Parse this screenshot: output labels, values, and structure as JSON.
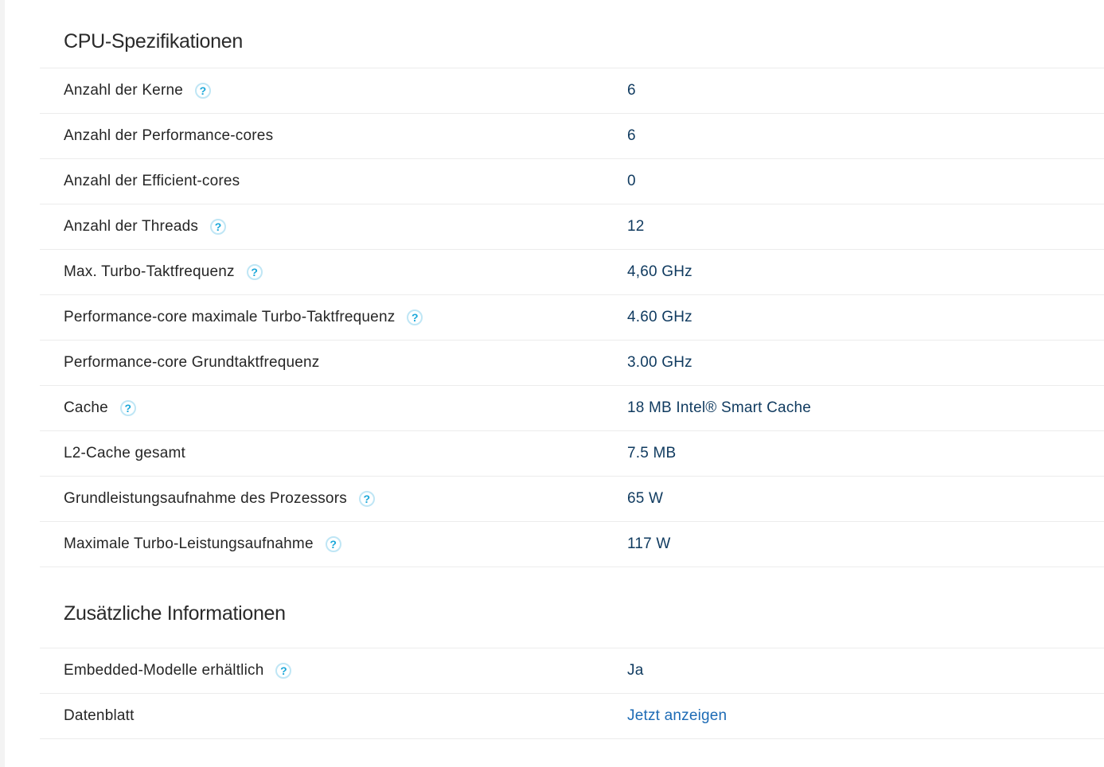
{
  "cpu_spec": {
    "title": "CPU-Spezifikationen",
    "rows": [
      {
        "label": "Anzahl der Kerne",
        "value": "6",
        "help": true
      },
      {
        "label": "Anzahl der Performance-cores",
        "value": "6",
        "help": false
      },
      {
        "label": "Anzahl der Efficient-cores",
        "value": "0",
        "help": false
      },
      {
        "label": "Anzahl der Threads",
        "value": "12",
        "help": true
      },
      {
        "label": "Max. Turbo-Taktfrequenz",
        "value": "4,60 GHz",
        "help": true
      },
      {
        "label": "Performance-core maximale Turbo-Taktfrequenz",
        "value": "4.60 GHz",
        "help": true
      },
      {
        "label": "Performance-core Grundtaktfrequenz",
        "value": "3.00 GHz",
        "help": false
      },
      {
        "label": "Cache",
        "value": "18 MB Intel® Smart Cache",
        "help": true
      },
      {
        "label": "L2-Cache gesamt",
        "value": "7.5 MB",
        "help": false
      },
      {
        "label": "Grundleistungsaufnahme des Prozessors",
        "value": "65 W",
        "help": true
      },
      {
        "label": "Maximale Turbo-Leistungsaufnahme",
        "value": "117 W",
        "help": true
      }
    ]
  },
  "additional_info": {
    "title": "Zusätzliche Informationen",
    "rows": [
      {
        "label": "Embedded-Modelle erhältlich",
        "value": "Ja",
        "help": true
      },
      {
        "label": "Datenblatt",
        "value": "Jetzt anzeigen",
        "help": false,
        "link": true
      }
    ]
  },
  "help_icon_glyph": "?",
  "colors": {
    "value_text": "#0f3a5f",
    "link": "#1d6bb5",
    "help_icon": "#1aa7d9"
  }
}
